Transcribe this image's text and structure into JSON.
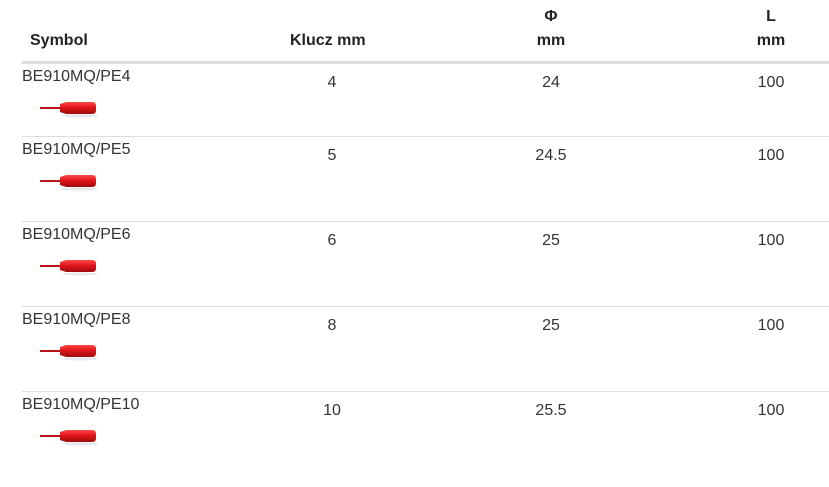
{
  "table": {
    "headers": {
      "symbol": "Symbol",
      "klucz": "Klucz mm",
      "phi_symbol": "Φ",
      "phi_unit": "mm",
      "length_symbol": "L",
      "length_unit": "mm"
    },
    "rows": [
      {
        "symbol": "BE910MQ/PE4",
        "klucz": "4",
        "phi": "24",
        "length": "100",
        "image": "red-screwdriver-bit"
      },
      {
        "symbol": "BE910MQ/PE5",
        "klucz": "5",
        "phi": "24.5",
        "length": "100",
        "image": "red-screwdriver-bit"
      },
      {
        "symbol": "BE910MQ/PE6",
        "klucz": "6",
        "phi": "25",
        "length": "100",
        "image": "red-screwdriver-bit"
      },
      {
        "symbol": "BE910MQ/PE8",
        "klucz": "8",
        "phi": "25",
        "length": "100",
        "image": "red-screwdriver-bit"
      },
      {
        "symbol": "BE910MQ/PE10",
        "klucz": "10",
        "phi": "25.5",
        "length": "100",
        "image": "red-screwdriver-bit"
      }
    ]
  },
  "colors": {
    "accent_red": "#e0161b",
    "rule_gray": "#dddddd",
    "text": "#333333"
  }
}
